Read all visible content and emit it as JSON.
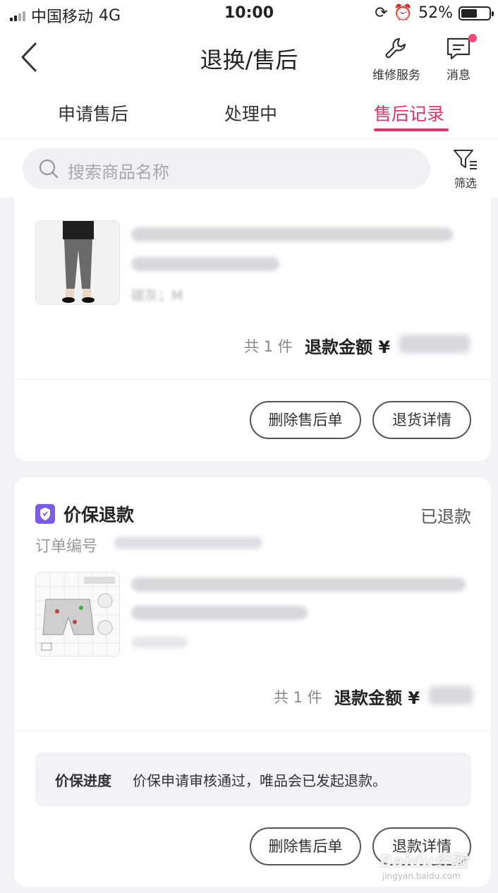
{
  "status_bar": {
    "carrier": "中国移动",
    "network": "4G",
    "time": "10:00",
    "battery": "52%",
    "battery_level": 0.52
  },
  "nav": {
    "title": "退换/售后",
    "repair_label": "维修服务",
    "message_label": "消息"
  },
  "tabs": [
    {
      "label": "申请售后",
      "active": false
    },
    {
      "label": "处理中",
      "active": false
    },
    {
      "label": "售后记录",
      "active": true
    }
  ],
  "search": {
    "placeholder": "搜索商品名称",
    "filter_label": "筛选"
  },
  "orders": [
    {
      "sku": "碳灰；M",
      "quantity": "共 1 件",
      "refund_label": "退款金额 ¥",
      "buttons": [
        "删除售后单",
        "退货详情"
      ]
    },
    {
      "type_label": "价保退款",
      "status": "已退款",
      "order_no_label": "订单编号",
      "quantity": "共 1 件",
      "refund_label": "退款金额 ¥",
      "progress_label": "价保进度",
      "progress_text": "价保申请审核通过，唯品会已发起退款。",
      "buttons": [
        "删除售后单",
        "退款详情"
      ]
    }
  ],
  "accent_color": "#e2336b",
  "badge_color": "#7c5ce6",
  "watermark": "Baidu经验",
  "watermark_url": "jingyan.baidu.com"
}
